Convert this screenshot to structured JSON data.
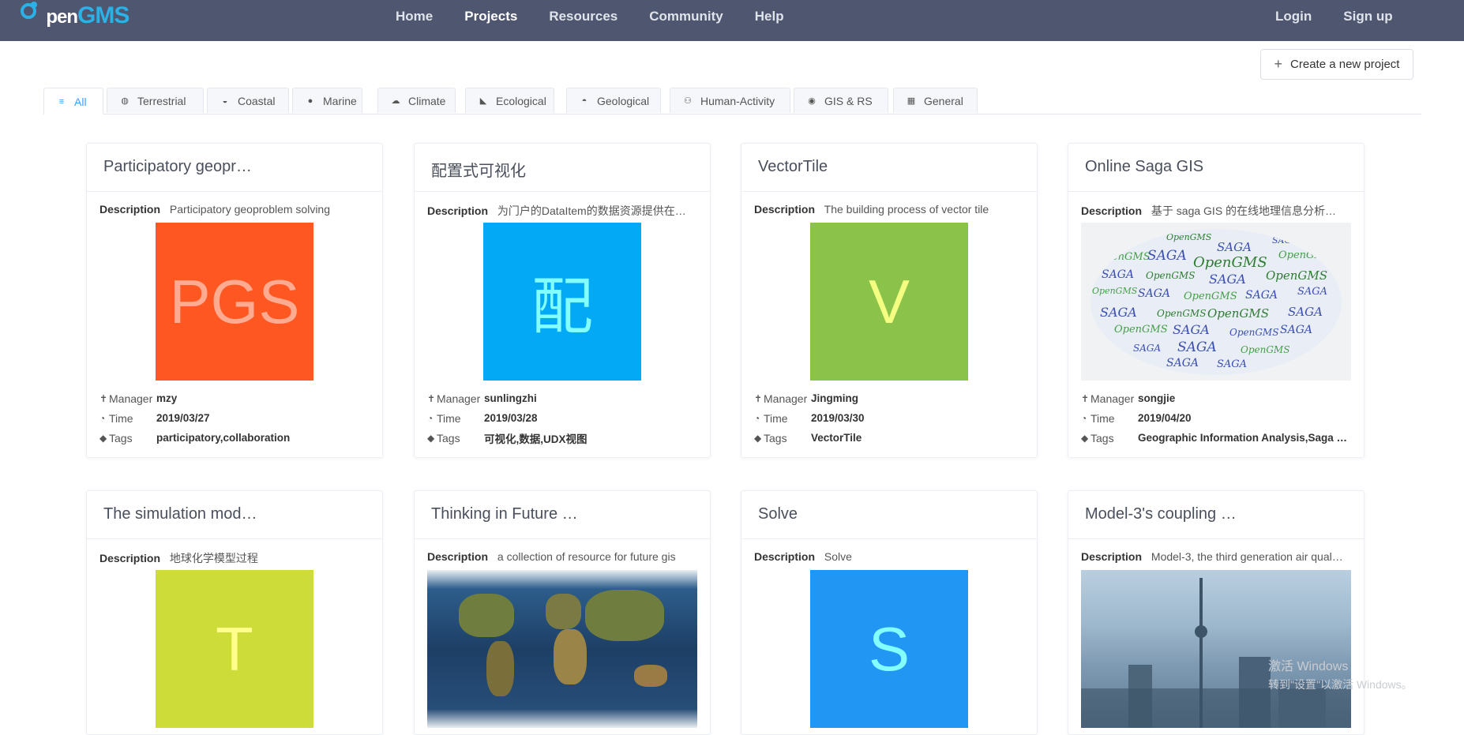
{
  "nav": {
    "logo_prefix": "O",
    "logo_main": "pen",
    "logo_suffix": "GMS",
    "items": [
      "Home",
      "Projects",
      "Resources",
      "Community",
      "Help"
    ],
    "active": "Projects",
    "login": "Login",
    "signup": "Sign up"
  },
  "create_button": {
    "label": "Create a new project",
    "icon": "plus-icon"
  },
  "tabs": [
    {
      "label": "All",
      "icon": "list-icon"
    },
    {
      "label": "Terrestrial",
      "icon": "globe-icon"
    },
    {
      "label": "Coastal",
      "icon": "coastal-icon"
    },
    {
      "label": "Marine",
      "icon": "drop-icon"
    },
    {
      "label": "Climate",
      "icon": "cloud-icon"
    },
    {
      "label": "Ecological",
      "icon": "leaf-icon"
    },
    {
      "label": "Geological",
      "icon": "mountain-icon"
    },
    {
      "label": "Human-Activity",
      "icon": "people-icon"
    },
    {
      "label": "GIS & RS",
      "icon": "satellite-icon"
    },
    {
      "label": "General",
      "icon": "grid-icon"
    }
  ],
  "labels": {
    "description": "Description",
    "manager": "Manager",
    "time": "Time",
    "tags": "Tags"
  },
  "projects": [
    {
      "title": "Participatory geopr…",
      "description": "Participatory geoproblem solving",
      "thumb_text": "PGS",
      "thumb_bg": "#ff5722",
      "thumb_fg": "#ffab91",
      "manager": "mzy",
      "time": "2019/03/27",
      "tags": "participatory,collaboration"
    },
    {
      "title": "配置式可视化",
      "description": "为门户的DataItem的数据资源提供在…",
      "thumb_text": "配",
      "thumb_bg": "#03a9f4",
      "thumb_fg": "#84ffff",
      "manager": "sunlingzhi",
      "time": "2019/03/28",
      "tags": "可视化,数据,UDX视图"
    },
    {
      "title": "VectorTile",
      "description": "The building process of vector tile",
      "thumb_text": "V",
      "thumb_bg": "#8bc34a",
      "thumb_fg": "#f4ff81",
      "manager": "Jingming",
      "time": "2019/03/30",
      "tags": "VectorTile"
    },
    {
      "title": "Online Saga GIS",
      "description": "基于 saga GIS 的在线地理信息分析…",
      "thumb_text": "",
      "thumb_bg": "#f1f2f4",
      "thumb_fg": "#333333",
      "manager": "songjie",
      "time": "2019/04/20",
      "tags": "Geographic Information Analysis,Saga …"
    },
    {
      "title": "The simulation mod…",
      "description": "地球化学模型过程",
      "thumb_text": "T",
      "thumb_bg": "#cddc39",
      "thumb_fg": "#ffff8d",
      "manager": "",
      "time": "",
      "tags": ""
    },
    {
      "title": "Thinking in Future …",
      "description": "a collection of resource for future gis",
      "thumb_text": "",
      "thumb_bg": "#1d3f66",
      "thumb_fg": "#ffffff",
      "manager": "",
      "time": "",
      "tags": ""
    },
    {
      "title": "Solve",
      "description": "Solve",
      "thumb_text": "S",
      "thumb_bg": "#2196f3",
      "thumb_fg": "#84ffff",
      "manager": "",
      "time": "",
      "tags": ""
    },
    {
      "title": "Model-3's coupling …",
      "description": "Model-3, the third generation air qual…",
      "thumb_text": "",
      "thumb_bg": "#9db7cc",
      "thumb_fg": "#ffffff",
      "manager": "",
      "time": "",
      "tags": ""
    }
  ],
  "saga_cloud": {
    "words": [
      "SAGA",
      "OpenGMS"
    ]
  },
  "watermark": {
    "line1": "激活 Windows",
    "line2": "转到\"设置\"以激活 Windows。"
  }
}
